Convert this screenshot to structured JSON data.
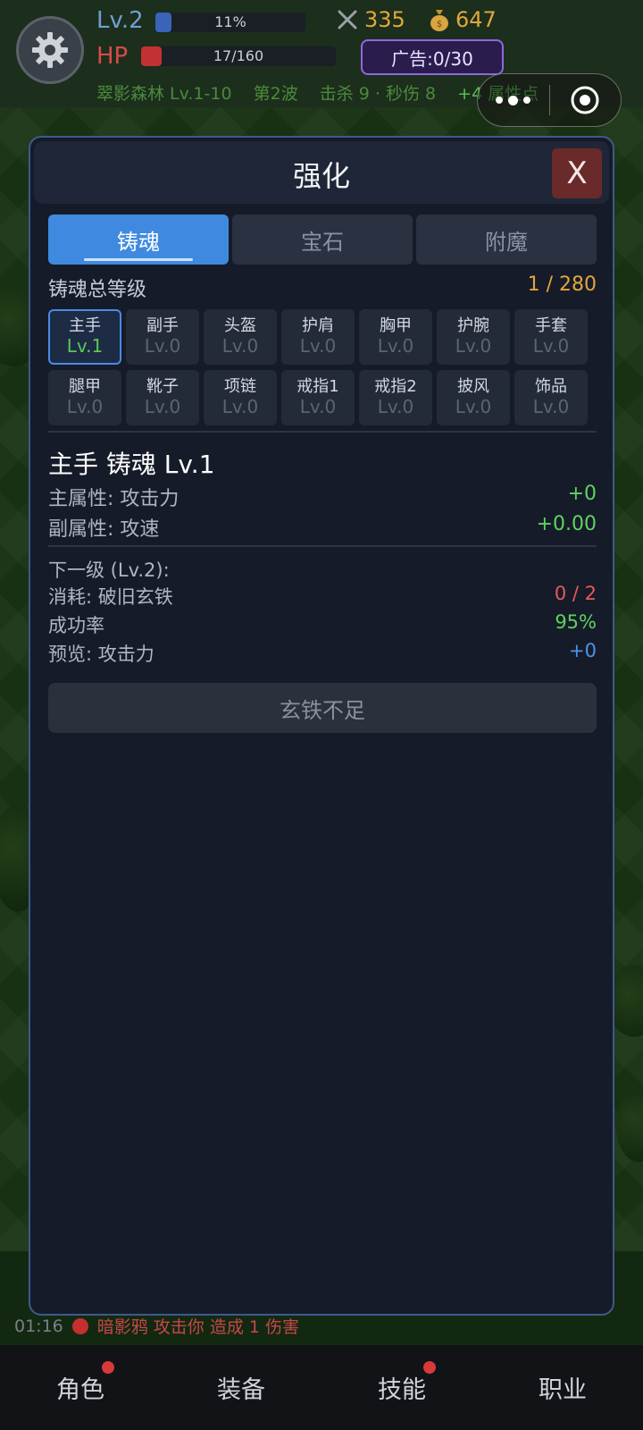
{
  "hud": {
    "level": "Lv.2",
    "xp_percent": "11%",
    "xp_fraction": 0.11,
    "hp_label": "HP",
    "hp_value": "17/160",
    "hp_fraction": 0.106,
    "attack": "335",
    "gold": "647",
    "ad_button": "广告:0/30",
    "area": "翠影森林 Lv.1-10",
    "wave": "第2波",
    "kills": "击杀 9 · 秒伤 8",
    "points": "+4 属性点"
  },
  "modal": {
    "title": "强化",
    "close_label": "X",
    "tabs": [
      {
        "label": "铸魂",
        "active": true
      },
      {
        "label": "宝石",
        "active": false
      },
      {
        "label": "附魔",
        "active": false
      }
    ],
    "total_label": "铸魂总等级",
    "total_value": "1 / 280",
    "slots": [
      {
        "name": "主手",
        "level": "Lv.1"
      },
      {
        "name": "副手",
        "level": "Lv.0"
      },
      {
        "name": "头盔",
        "level": "Lv.0"
      },
      {
        "name": "护肩",
        "level": "Lv.0"
      },
      {
        "name": "胸甲",
        "level": "Lv.0"
      },
      {
        "name": "护腕",
        "level": "Lv.0"
      },
      {
        "name": "手套",
        "level": "Lv.0"
      },
      {
        "name": "腿甲",
        "level": "Lv.0"
      },
      {
        "name": "靴子",
        "level": "Lv.0"
      },
      {
        "name": "项链",
        "level": "Lv.0"
      },
      {
        "name": "戒指1",
        "level": "Lv.0"
      },
      {
        "name": "戒指2",
        "level": "Lv.0"
      },
      {
        "name": "披风",
        "level": "Lv.0"
      },
      {
        "name": "饰品",
        "level": "Lv.0"
      }
    ],
    "detail": {
      "title": "主手 铸魂 Lv.1",
      "main_attr_label": "主属性: 攻击力",
      "main_attr_value": "+0",
      "sub_attr_label": "副属性: 攻速",
      "sub_attr_value": "+0.00",
      "next_level_label": "下一级 (Lv.2):",
      "cost_label": "消耗: 破旧玄铁",
      "cost_value": "0 / 2",
      "success_label": "成功率",
      "success_value": "95%",
      "preview_label": "预览: 攻击力",
      "preview_value": "+0",
      "action_button": "玄铁不足"
    }
  },
  "log": {
    "time": "01:16",
    "message": "暗影鸦 攻击你 造成 1 伤害"
  },
  "bottom_nav": [
    {
      "label": "角色",
      "badge": true
    },
    {
      "label": "装备",
      "badge": false
    },
    {
      "label": "技能",
      "badge": true
    },
    {
      "label": "职业",
      "badge": false
    }
  ],
  "colors": {
    "accent": "#3f8ae0",
    "positive": "#5ed35f",
    "negative": "#e85a5a",
    "gold": "#e0a83a"
  }
}
